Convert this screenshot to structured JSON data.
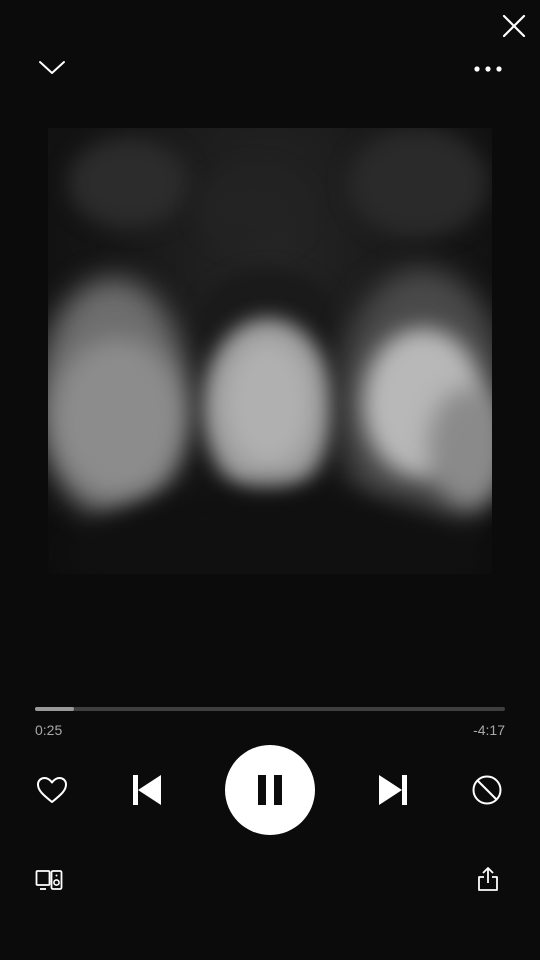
{
  "player": {
    "elapsed": "0:25",
    "remaining": "-4:17",
    "progress_fraction": 0.083,
    "is_playing": true
  },
  "icons": {
    "close": "close-icon",
    "collapse": "chevron-down-icon",
    "more": "more-dots-icon",
    "like": "heart-icon",
    "previous": "skip-previous-icon",
    "pause": "pause-icon",
    "next": "skip-next-icon",
    "block": "block-icon",
    "devices": "connect-devices-icon",
    "share": "share-icon"
  },
  "colors": {
    "background": "#0b0b0b",
    "accent": "#ffffff",
    "muted": "#a8a8a8"
  }
}
